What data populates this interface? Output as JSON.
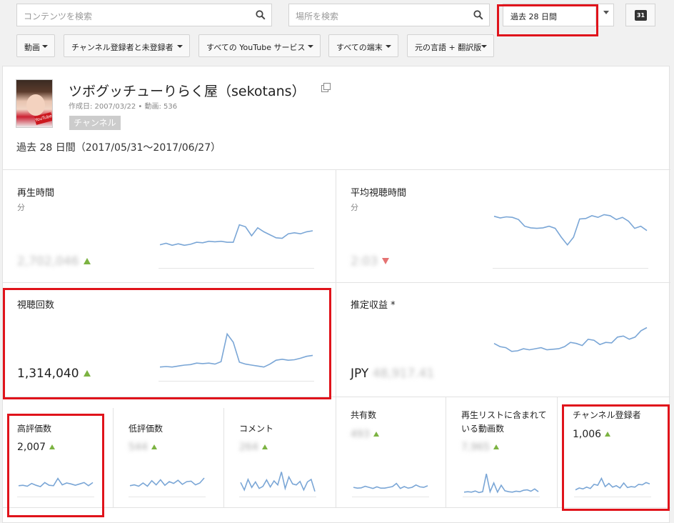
{
  "search": {
    "content_placeholder": "コンテンツを検索",
    "location_placeholder": "場所を検索"
  },
  "date_range": {
    "value": "過去 28 日間",
    "calendar_day": "31"
  },
  "filters": [
    "動画",
    "チャンネル登録者と未登録者",
    "すべての YouTube サービス",
    "すべての端末",
    "元の言語 + 翻訳版"
  ],
  "channel": {
    "name": "ツボグッチューりらく屋（sekotans）",
    "meta": "作成日: 2007/03/22 • 動画: 536",
    "badge": "チャンネル",
    "period": "過去 28 日間（2017/05/31～2017/06/27）"
  },
  "metrics": {
    "watch_time": {
      "label": "再生時間",
      "unit": "分",
      "value": "2,702,046",
      "trend": "up"
    },
    "avg_duration": {
      "label": "平均視聴時間",
      "unit": "分",
      "value": "2:03",
      "trend": "down"
    },
    "views": {
      "label": "視聴回数",
      "value": "1,314,040",
      "trend": "up"
    },
    "revenue": {
      "label": "推定収益 *",
      "currency": "JPY",
      "value": "48,917.41"
    }
  },
  "small_metrics": {
    "likes": {
      "label": "高評価数",
      "value": "2,007",
      "trend": "up"
    },
    "dislikes": {
      "label": "低評価数",
      "value": "544",
      "trend": "up"
    },
    "comments": {
      "label": "コメント",
      "value": "264",
      "trend": "up"
    },
    "shares": {
      "label": "共有数",
      "value": "493",
      "trend": "up"
    },
    "playlist": {
      "label": "再生リストに含まれている動画数",
      "value": "7,965",
      "trend": "up"
    },
    "subscribers": {
      "label": "チャンネル登録者",
      "value": "1,006",
      "trend": "up"
    }
  },
  "colors": {
    "sparkline": "#7aa6d6",
    "trend_up": "#7cb342",
    "trend_down": "#e57373",
    "highlight": "#e0131b"
  }
}
